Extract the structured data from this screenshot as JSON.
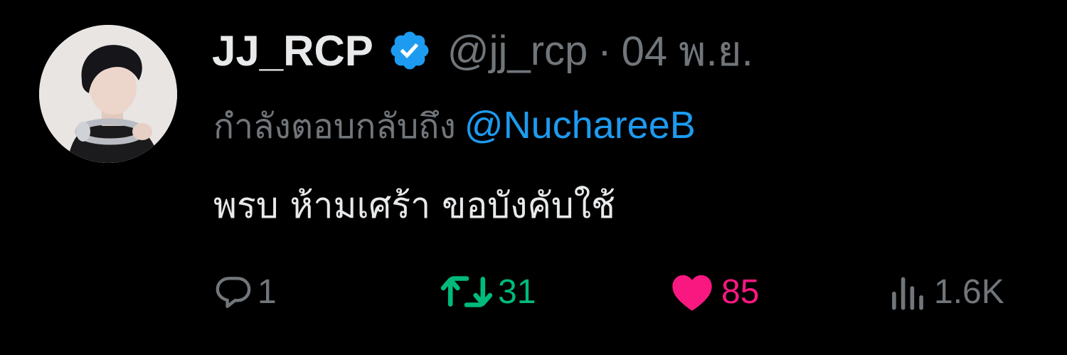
{
  "author": {
    "display_name": "JJ_RCP",
    "handle": "@jj_rcp",
    "verified": true
  },
  "meta": {
    "separator": "·",
    "date": "04 พ.ย."
  },
  "reply": {
    "prefix": "กำลังตอบกลับถึง",
    "mention": "@NuchareeB"
  },
  "tweet": {
    "text": "พรบ ห้ามเศร้า ขอบังคับใช้"
  },
  "actions": {
    "replies": "1",
    "retweets": "31",
    "likes": "85",
    "views": "1.6K"
  },
  "colors": {
    "background": "#000000",
    "text": "#e7e9ea",
    "muted": "#71767b",
    "link": "#1d9bf0",
    "retweet": "#00ba7c",
    "like": "#f91880"
  },
  "icons": [
    "verified-badge-icon",
    "reply-icon",
    "retweet-icon",
    "heart-icon",
    "views-icon"
  ]
}
